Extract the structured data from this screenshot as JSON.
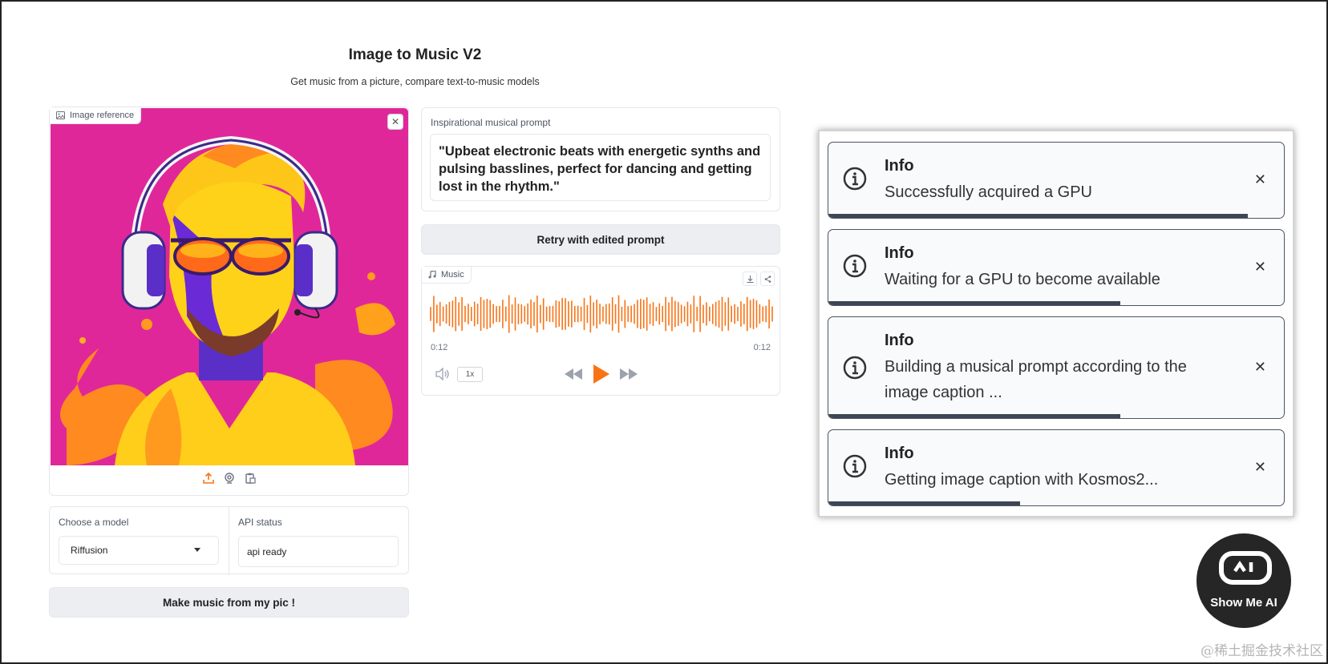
{
  "header": {
    "title": "Image to Music V2",
    "subtitle": "Get music from a picture, compare text-to-music models"
  },
  "image_panel": {
    "label": "Image reference",
    "icons": [
      "upload-icon",
      "webcam-icon",
      "clipboard-icon"
    ]
  },
  "model": {
    "label": "Choose a model",
    "selected": "Riffusion"
  },
  "api_status": {
    "label": "API status",
    "value": "api ready"
  },
  "make_button": "Make music from my pic !",
  "prompt": {
    "label": "Inspirational musical prompt",
    "value": "\"Upbeat electronic beats with energetic synths and pulsing basslines, perfect for dancing and getting lost in the rhythm.\""
  },
  "retry_button": "Retry with edited prompt",
  "audio": {
    "label": "Music",
    "time_start": "0:12",
    "time_end": "0:12",
    "speed": "1x",
    "waveform_color": "#f97316"
  },
  "toasts": [
    {
      "title": "Info",
      "message": "Successfully acquired a GPU",
      "progress": 0.92
    },
    {
      "title": "Info",
      "message": "Waiting for a GPU to become available",
      "progress": 0.64
    },
    {
      "title": "Info",
      "message": "Building a musical prompt according to the image caption ...",
      "progress": 0.64
    },
    {
      "title": "Info",
      "message": "Getting image caption with Kosmos2...",
      "progress": 0.42
    }
  ],
  "badge": {
    "text": "Show Me AI"
  },
  "watermark": "@稀土掘金技术社区"
}
